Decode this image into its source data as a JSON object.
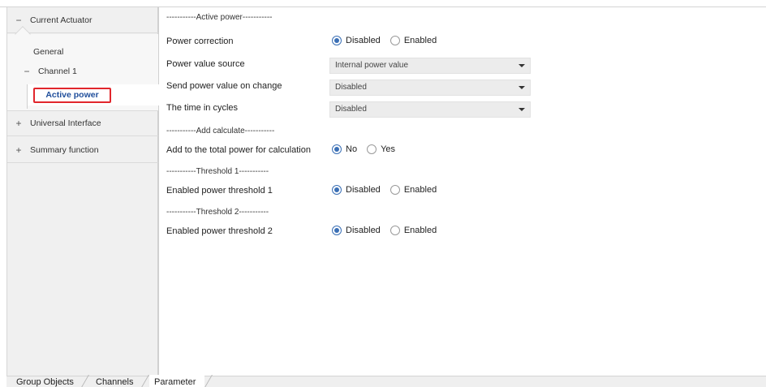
{
  "sidebar": {
    "items": [
      {
        "sign": "−",
        "label": "Current Actuator"
      },
      {
        "label": "General"
      },
      {
        "sign": "−",
        "label": "Channel 1"
      },
      {
        "label": "Active power"
      },
      {
        "sign": "+",
        "label": "Universal Interface"
      },
      {
        "sign": "+",
        "label": "Summary function"
      }
    ]
  },
  "params": {
    "section_active": "-----------Active power-----------",
    "power_correction": {
      "label": "Power correction",
      "options": [
        "Disabled",
        "Enabled"
      ],
      "selected": "Disabled"
    },
    "power_value_source": {
      "label": "Power value source",
      "value": "Internal power value"
    },
    "send_power_value": {
      "label": "Send power value on change",
      "value": "Disabled"
    },
    "time_in_cycles": {
      "label": "The time in cycles",
      "value": "Disabled"
    },
    "section_add": "-----------Add calculate-----------",
    "add_total": {
      "label": "Add to the total power for calculation",
      "options": [
        "No",
        "Yes"
      ],
      "selected": "No"
    },
    "section_th1": "-----------Threshold 1-----------",
    "threshold1": {
      "label": "Enabled power threshold 1",
      "options": [
        "Disabled",
        "Enabled"
      ],
      "selected": "Disabled"
    },
    "section_th2": "-----------Threshold 2-----------",
    "threshold2": {
      "label": "Enabled power threshold 2",
      "options": [
        "Disabled",
        "Enabled"
      ],
      "selected": "Disabled"
    }
  },
  "bottom_tabs": [
    {
      "label": "Group Objects"
    },
    {
      "label": "Channels"
    },
    {
      "label": "Parameter",
      "active": true
    }
  ],
  "colors": {
    "accent": "#3a6fb5",
    "highlight_border": "#e1262c",
    "active_text": "#1f4e9b"
  }
}
